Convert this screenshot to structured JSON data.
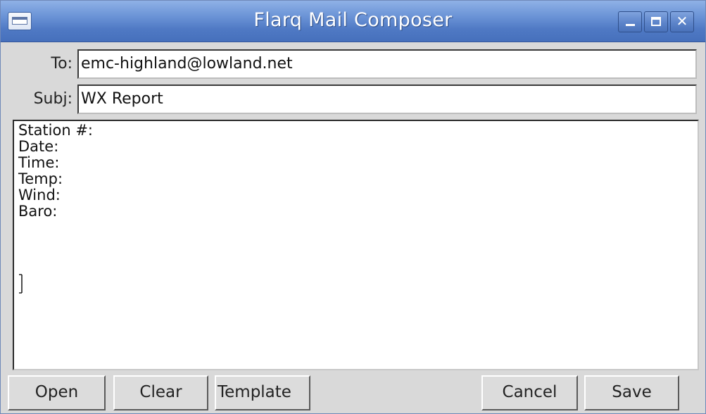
{
  "window": {
    "title": "Flarq Mail Composer",
    "titlebar_color": "#5b83c9"
  },
  "fields": {
    "to_label": "To:",
    "to_value": "emc-highland@lowland.net",
    "subj_label": "Subj:",
    "subj_value": "WX Report"
  },
  "body": {
    "lines": [
      "Station #:",
      "Date:",
      "Time:",
      "Temp:",
      "Wind:",
      "Baro:"
    ]
  },
  "buttons": {
    "open": "Open",
    "clear": "Clear",
    "template": "Template",
    "cancel": "Cancel",
    "save": "Save"
  }
}
